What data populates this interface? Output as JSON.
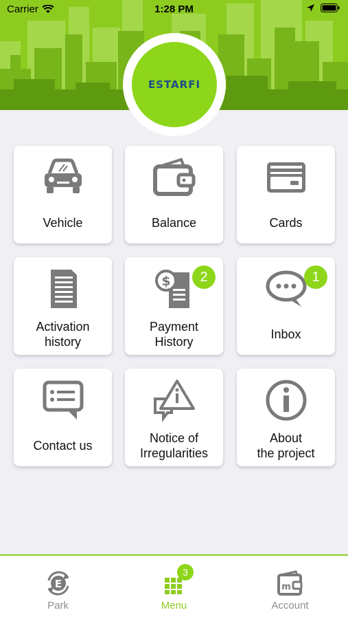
{
  "status_bar": {
    "carrier": "Carrier",
    "time": "1:28 PM"
  },
  "logo": {
    "text": "ESTARFI"
  },
  "colors": {
    "accent": "#8dcc1f",
    "icon_gray": "#7a7a7a",
    "logo_text": "#1e4f88"
  },
  "menu": {
    "tiles": [
      {
        "icon": "car-icon",
        "lines": [
          "Vehicle"
        ]
      },
      {
        "icon": "wallet-icon",
        "lines": [
          "Balance"
        ]
      },
      {
        "icon": "credit-card-icon",
        "lines": [
          "Cards"
        ]
      },
      {
        "icon": "document-icon",
        "lines": [
          "Activation",
          "history"
        ]
      },
      {
        "icon": "payment-receipt-icon",
        "lines": [
          "Payment",
          "History"
        ],
        "badge": "2"
      },
      {
        "icon": "chat-bubble-icon",
        "lines": [
          "Inbox"
        ],
        "badge": "1"
      },
      {
        "icon": "message-icon",
        "lines": [
          "Contact us"
        ]
      },
      {
        "icon": "warning-chat-icon",
        "lines": [
          "Notice of",
          "Irregularities"
        ]
      },
      {
        "icon": "info-icon",
        "lines": [
          "About",
          "the project"
        ]
      }
    ]
  },
  "tabbar": {
    "tabs": [
      {
        "label": "Park",
        "icon": "park-icon",
        "active": false
      },
      {
        "label": "Menu",
        "icon": "grid-icon",
        "active": true,
        "badge": "3"
      },
      {
        "label": "Account",
        "icon": "account-wallet-icon",
        "active": false
      }
    ]
  }
}
